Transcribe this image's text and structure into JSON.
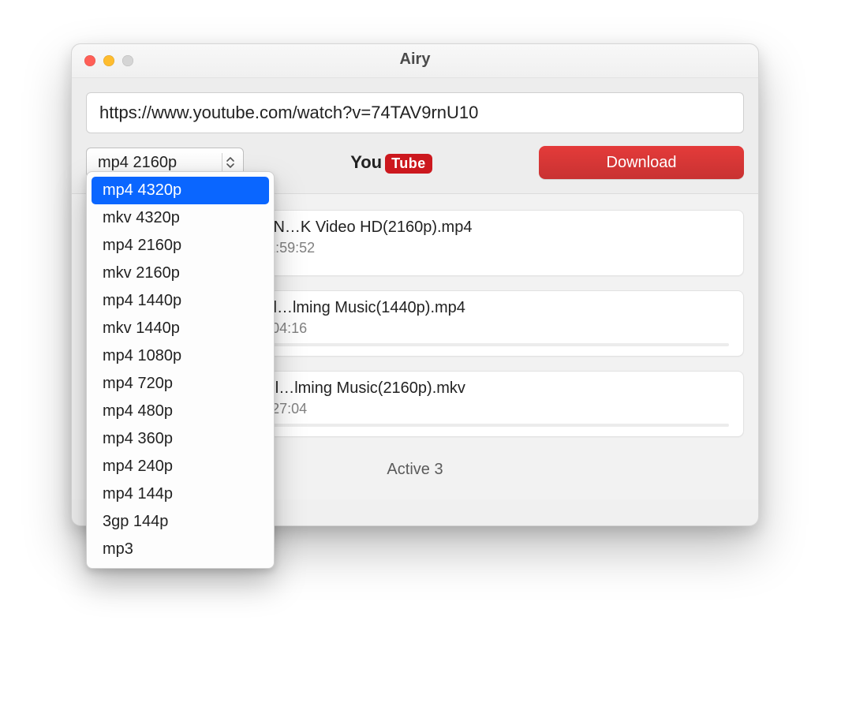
{
  "window": {
    "title": "Airy"
  },
  "toolbar": {
    "url_value": "https://www.youtube.com/watch?v=74TAV9rnU10",
    "format_selected": "mp4 2160p",
    "youtube_you": "You",
    "youtube_tube": "Tube",
    "download_label": "Download"
  },
  "format_options": [
    "mp4 4320p",
    "mkv 4320p",
    "mp4 2160p",
    "mkv 2160p",
    "mp4 1440p",
    "mkv 1440p",
    "mp4 1080p",
    "mp4 720p",
    "mp4 480p",
    "mp4 360p",
    "mp4 240p",
    "mp4 144p",
    "3gp 144p",
    "mp3"
  ],
  "format_highlight_index": 0,
  "downloads": [
    {
      "title": "ING OVER LONDON…K Video HD(2160p).mp4",
      "sub": "0 GB of 18.54 GB / 01:59:52",
      "progress_pct": 0
    },
    {
      "title": "way 4K - Scenic Rel…lming Music(1440p).mp4",
      "sub": "2 GB of 3.27 GB / 00:04:16",
      "progress_pct": 8
    },
    {
      "title": "aine 4K - Scenic Rel…lming Music(2160p).mkv",
      "sub": "4 GB of 7.36 GB / 00:27:04",
      "progress_pct": 18
    }
  ],
  "status": {
    "text": "Active 3"
  }
}
